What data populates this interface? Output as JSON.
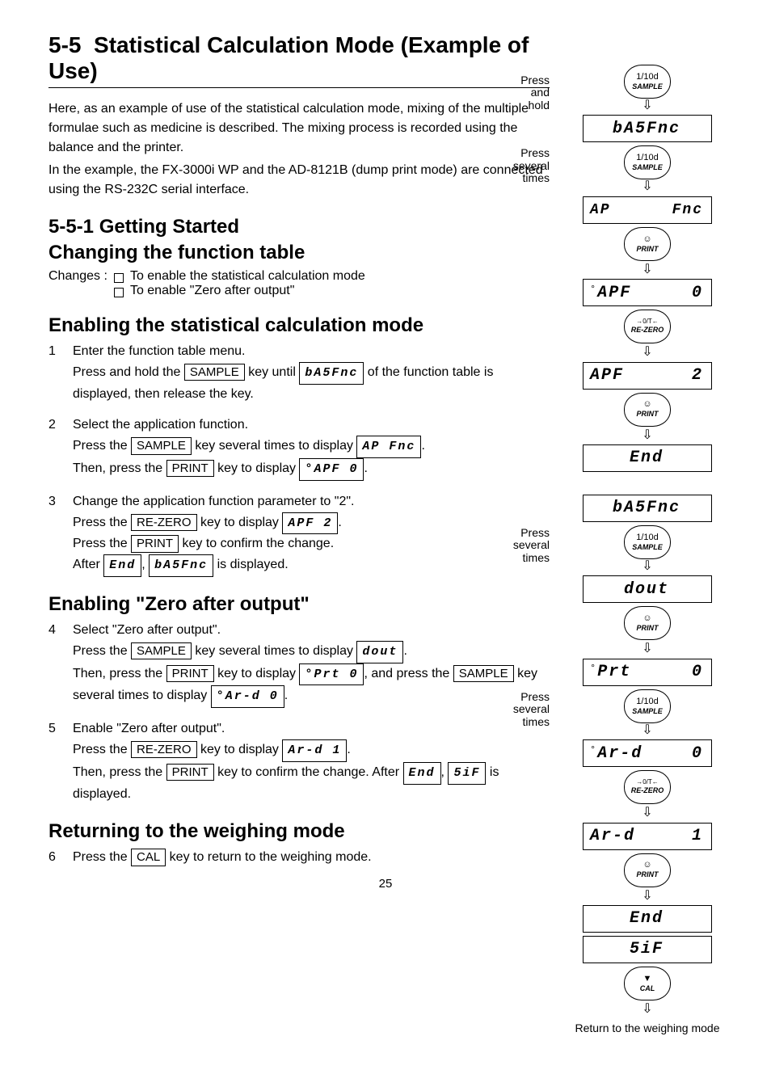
{
  "section": {
    "number": "5-5",
    "title": "Statistical Calculation Mode (Example of Use)"
  },
  "intro": {
    "p1": "Here, as an example of use of the statistical calculation mode, mixing of the multiple formulae such as medicine is described. The mixing process is recorded using the balance and the printer.",
    "p2": "In the example, the FX-3000i WP and the AD-8121B (dump print mode) are connected using the RS-232C serial interface."
  },
  "sub1": {
    "num": "5-5-1",
    "title1": "Getting Started",
    "title2": "Changing the function table",
    "changes_label": "Changes :",
    "items": [
      "To enable the statistical calculation mode",
      "To enable \"Zero after output\""
    ]
  },
  "enable_stat": {
    "title": "Enabling the statistical calculation mode",
    "steps": {
      "step1_line1": "Enter the function table menu.",
      "step1_line2a": "Press and hold the ",
      "step1_key1": "SAMPLE",
      "step1_line2b": " key until ",
      "step1_seg": "bA5Fnc",
      "step1_line2c": " of the function table is displayed, then release the key.",
      "step2_line1": "Select the application function.",
      "step2_line2a": "Press the ",
      "step2_key1": "SAMPLE",
      "step2_line2b": " key several times to display ",
      "step2_seg1": "AP Fnc",
      "step2_line3a": "Then, press the ",
      "step2_key2": "PRINT",
      "step2_line3b": " key to display ",
      "step2_seg2": "°APF 0",
      "step3_line1": "Change the application function parameter to \"2\".",
      "step3_line2a": "Press the ",
      "step3_key1": "RE-ZERO",
      "step3_line2b": " key to display ",
      "step3_seg1": "APF 2",
      "step3_line3a": "Press the ",
      "step3_key2": "PRINT",
      "step3_line3b": " key to confirm the change.",
      "step3_line4a": "After ",
      "step3_seg2": "End",
      "step3_line4b": ", ",
      "step3_seg3": "bA5Fnc",
      "step3_line4c": " is displayed."
    }
  },
  "enable_zero": {
    "title": "Enabling \"Zero after output\"",
    "steps": {
      "step4_line1": "Select \"Zero after output\".",
      "step4_line2a": "Press the ",
      "step4_key1": "SAMPLE",
      "step4_line2b": " key several times to display ",
      "step4_seg1": "dout",
      "step4_line3a": "Then, press the ",
      "step4_key2": "PRINT",
      "step4_line3b": " key to display ",
      "step4_seg2": "°Prt 0",
      "step4_line3c": ", and press the ",
      "step4_key3": "SAMPLE",
      "step4_line3d": " key several times to display ",
      "step4_seg3": "°Ar-d 0",
      "step5_line1": "Enable \"Zero after output\".",
      "step5_line2a": "Press the ",
      "step5_key1": "RE-ZERO",
      "step5_line2b": " key to display ",
      "step5_seg1": "Ar-d 1",
      "step5_line3a": "Then, press the ",
      "step5_key2": "PRINT",
      "step5_line3b": " key to confirm the change. After ",
      "step5_seg2": "End",
      "step5_line3c": ", ",
      "step5_seg3": "5iF",
      "step5_line3d": " is displayed."
    }
  },
  "return": {
    "title": "Returning to the weighing mode",
    "step6a": "Press the ",
    "step6_key": "CAL",
    "step6b": " key to return to the weighing mode."
  },
  "side": {
    "press_hold": "Press and hold",
    "press": "Press",
    "several": "several times",
    "displays": {
      "ba5fnc": "bA5Fnc",
      "apfnc": "AP Fnc",
      "apf0_pre": "°",
      "apf0": "APF",
      "apf0_val": "0",
      "apf2": "APF",
      "apf2_val": "2",
      "end": "End",
      "dout": "dout",
      "prt0_pre": "°",
      "prt": "Prt",
      "prt_val": "0",
      "ard0_pre": "°",
      "ard": "Ar-d",
      "ard0_val": "0",
      "ard1": "Ar-d",
      "ard1_val": "1",
      "sif": "5iF"
    },
    "keys": {
      "sample_top": "1/10d",
      "sample": "SAMPLE",
      "print_top": "☺",
      "print": "PRINT",
      "rezero_top": "→0/T←",
      "rezero": "RE-ZERO",
      "cal_top": "▼",
      "cal": "CAL"
    },
    "return_weigh": "Return to the weighing mode"
  },
  "page_no": "25"
}
